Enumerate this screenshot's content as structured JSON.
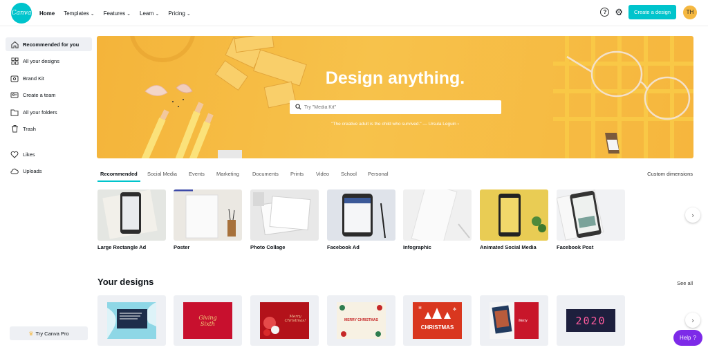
{
  "topbar": {
    "logo_text": "Canva",
    "nav": [
      {
        "label": "Home"
      },
      {
        "label": "Templates"
      },
      {
        "label": "Features"
      },
      {
        "label": "Learn"
      },
      {
        "label": "Pricing"
      }
    ],
    "create_label": "Create a design",
    "avatar_initials": "TH"
  },
  "sidebar": {
    "items": [
      {
        "label": "Recommended for you",
        "icon": "home-icon"
      },
      {
        "label": "All your designs",
        "icon": "grid-icon"
      },
      {
        "label": "Brand Kit",
        "icon": "brand-kit-icon"
      },
      {
        "label": "Create a team",
        "icon": "team-icon"
      },
      {
        "label": "All your folders",
        "icon": "folder-icon"
      },
      {
        "label": "Trash",
        "icon": "trash-icon"
      },
      {
        "label": "Likes",
        "icon": "heart-icon"
      },
      {
        "label": "Uploads",
        "icon": "upload-icon"
      }
    ],
    "try_pro_label": "Try Canva Pro"
  },
  "hero": {
    "title": "Design anything.",
    "search_placeholder": "Try \"Media Kit\"",
    "quote": "\"The creative adult is the child who survived.\" — Ursula Leguin ›"
  },
  "tabs": [
    {
      "label": "Recommended"
    },
    {
      "label": "Social Media"
    },
    {
      "label": "Events"
    },
    {
      "label": "Marketing"
    },
    {
      "label": "Documents"
    },
    {
      "label": "Prints"
    },
    {
      "label": "Video"
    },
    {
      "label": "School"
    },
    {
      "label": "Personal"
    }
  ],
  "custom_dimensions_label": "Custom dimensions",
  "templates": [
    {
      "label": "Large Rectangle Ad"
    },
    {
      "label": "Poster"
    },
    {
      "label": "Photo Collage"
    },
    {
      "label": "Facebook Ad"
    },
    {
      "label": "Infographic"
    },
    {
      "label": "Animated Social Media"
    },
    {
      "label": "Facebook Post"
    }
  ],
  "your_designs": {
    "title": "Your designs",
    "see_all_label": "See all",
    "thumb_texts": {
      "d2_a": "Giving",
      "d2_b": "Sixth",
      "d3": "Merry Christmas!",
      "d4": "MERRY CHRISTMAS",
      "d5": "CHRISTMAS",
      "d7": "2020"
    }
  },
  "help_label": "Help",
  "help_symbol": "?"
}
